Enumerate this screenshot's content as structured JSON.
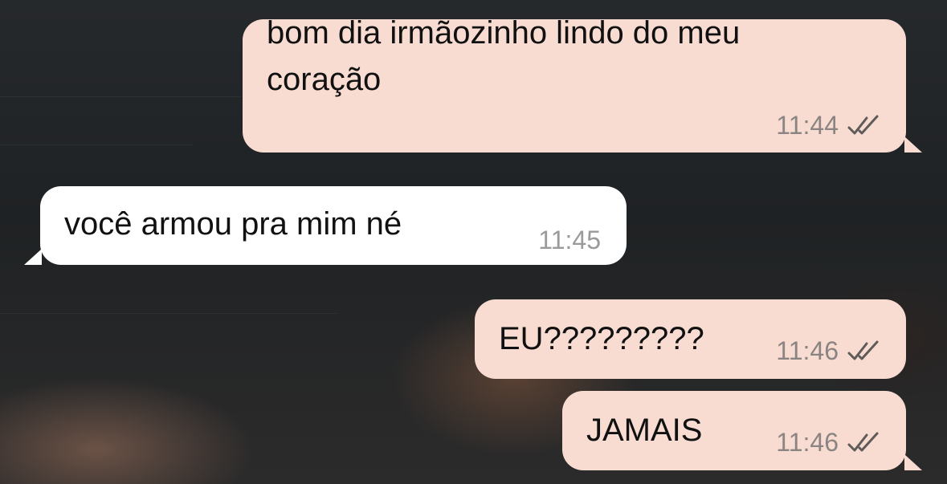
{
  "messages": [
    {
      "direction": "outgoing",
      "text": "bom dia irmãozinho lindo do meu\ncoração",
      "time": "11:44",
      "status": "read-double-check-icon"
    },
    {
      "direction": "incoming",
      "text": "você armou pra mim né",
      "time": "11:45"
    },
    {
      "direction": "outgoing",
      "text": "EU?????????",
      "time": "11:46",
      "status": "read-double-check-icon"
    },
    {
      "direction": "outgoing",
      "text": "JAMAIS",
      "time": "11:46",
      "status": "read-double-check-icon"
    }
  ],
  "colors": {
    "outgoing_bubble": "#f8dcd1",
    "incoming_bubble": "#ffffff",
    "timestamp": "#8a8582",
    "background": "#1f2224"
  }
}
